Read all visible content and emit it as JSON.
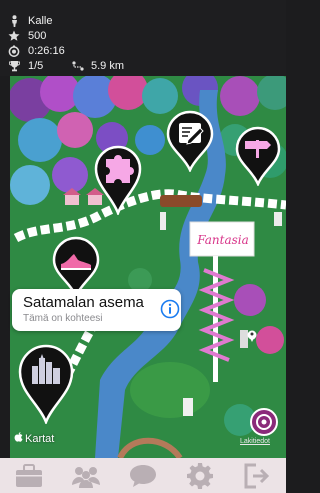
{
  "stats": {
    "player_name": "Kalle",
    "score": "500",
    "time": "0:26:16",
    "progress": "1/5",
    "distance": "5.9 km"
  },
  "map": {
    "fantasia_sign": "Fantasia",
    "callout": {
      "title": "Satamalan asema",
      "subtitle": "Tämä on kohteesi"
    },
    "attribution": "Kartat",
    "legal": "Lakitiedot",
    "markers": [
      "pencil-edit-icon",
      "signpost-icon",
      "puzzle-piece-icon",
      "sneaker-icon",
      "city-skyline-icon"
    ]
  },
  "tabbar": {
    "items": [
      "briefcase-icon",
      "team-icon",
      "chat-icon",
      "settings-gear-icon",
      "logout-icon"
    ]
  },
  "colors": {
    "marker_fill": "#111111",
    "icon_accent": "#f6a8e6",
    "route_line": "#ffffff",
    "tab_icon": "#b9afb4"
  }
}
